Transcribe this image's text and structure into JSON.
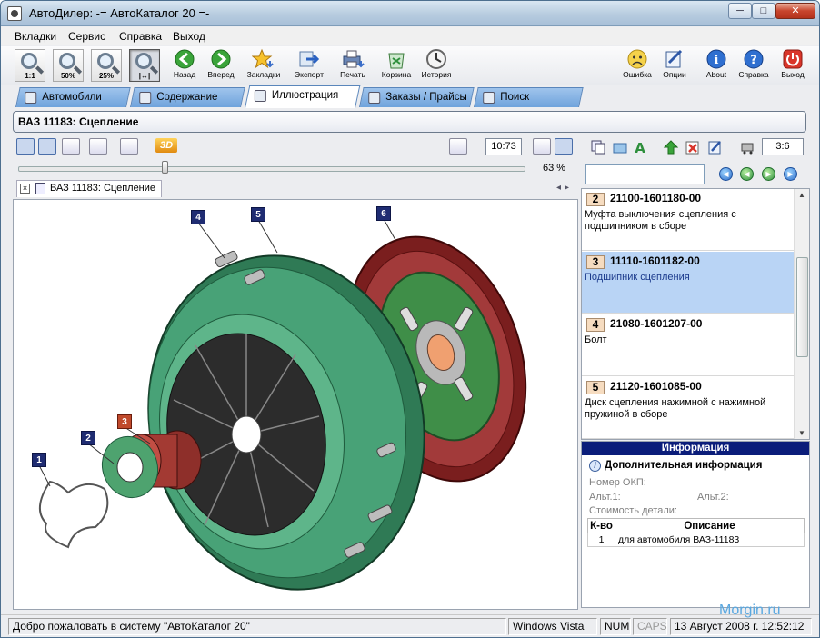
{
  "window": {
    "title": "АвтоДилер: -= АвтоКаталог 20 =-"
  },
  "menu": [
    "Вкладки",
    "Сервис",
    "Справка",
    "Выход"
  ],
  "toolbar": {
    "zoom": [
      "1:1",
      "50%",
      "25%",
      "|↔|"
    ],
    "buttons": [
      "Назад",
      "Вперед",
      "Закладки",
      "Экспорт",
      "Печать",
      "Корзина",
      "История"
    ],
    "right_buttons": [
      "Ошибка",
      "Опции",
      "About",
      "Справка",
      "Выход"
    ]
  },
  "tabs": [
    "Автомобили",
    "Содержание",
    "Иллюстрация",
    "Заказы / Прайсы",
    "Поиск"
  ],
  "section_title": "ВАЗ 11183: Сцепление",
  "illustration": {
    "time": "10:73",
    "zoom_pct": "63 %",
    "zoom_value": 0.63,
    "doc_tab": "ВАЗ 11183: Сцепление",
    "callouts": [
      "1",
      "2",
      "3",
      "4",
      "5",
      "6"
    ]
  },
  "parts_panel": {
    "page": "3:6",
    "items": [
      {
        "num": "2",
        "code": "21100-1601180-00",
        "desc": "Муфта выключения сцепления с подшипником в сборе",
        "selected": false
      },
      {
        "num": "3",
        "code": "11110-1601182-00",
        "desc": "Подшипник сцепления",
        "selected": true
      },
      {
        "num": "4",
        "code": "21080-1601207-00",
        "desc": "Болт",
        "selected": false
      },
      {
        "num": "5",
        "code": "21120-1601085-00",
        "desc": "Диск сцепления нажимной с нажимной пружиной в сборе",
        "selected": false
      }
    ]
  },
  "info": {
    "header": "Информация",
    "subtitle": "Дополнительная информация",
    "okp_label": "Номер ОКП:",
    "alt1_label": "Альт.1:",
    "alt2_label": "Альт.2:",
    "cost_label": "Стоимость детали:",
    "table_headers": [
      "К-во",
      "Описание"
    ],
    "rows": [
      {
        "qty": "1",
        "desc": "для автомобиля ВАЗ-11183"
      }
    ]
  },
  "status": {
    "message": "Добро пожаловать в систему \"АвтоКаталог 20\"",
    "os": "Windows Vista",
    "num": "NUM",
    "caps": "CAPS",
    "datetime": "13 Август 2008 г. 12:52:12"
  },
  "watermark": "Morgin.ru",
  "colors": {
    "selected_row": "#b9d4f5",
    "info_header": "#0b1d7a",
    "tab": "#8bb6e6"
  }
}
